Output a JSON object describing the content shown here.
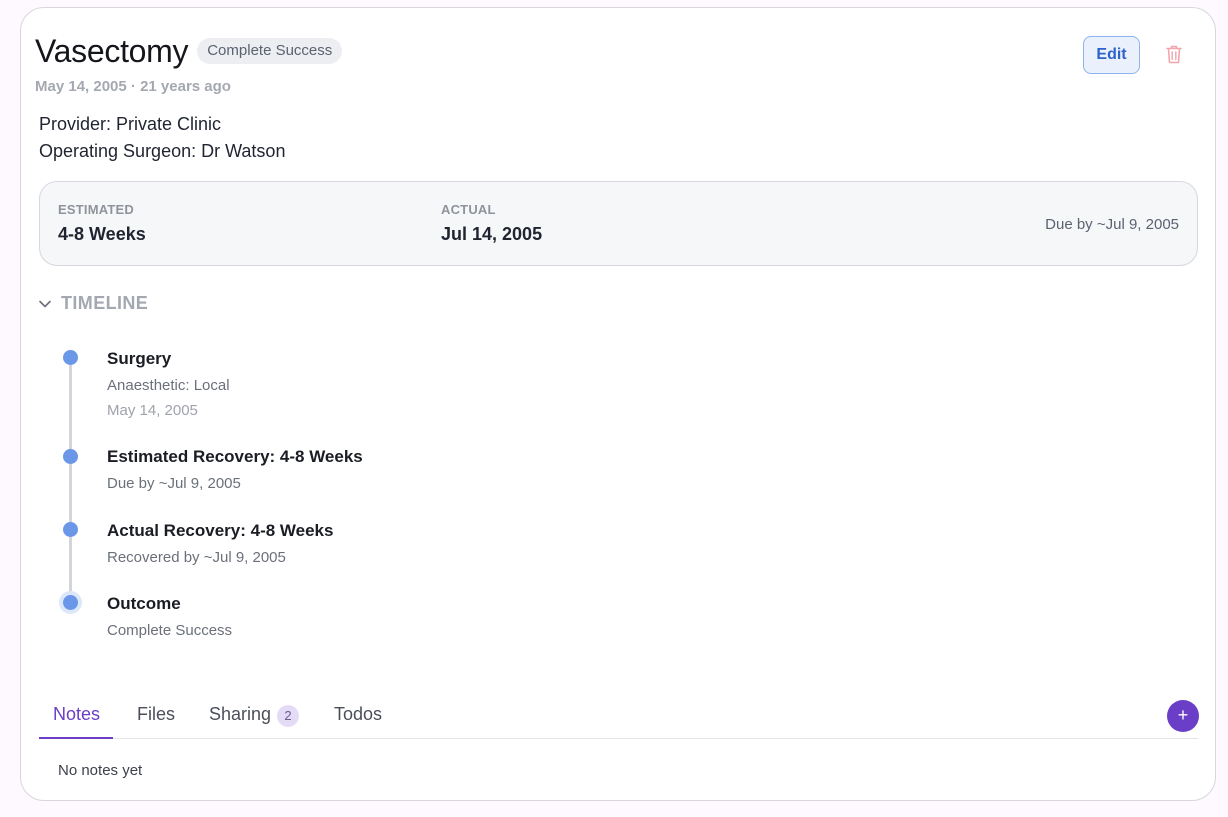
{
  "procedure": {
    "title": "Vasectomy",
    "status": "Complete Success",
    "date_line": "May 14, 2005 · 21 years ago",
    "edit_label": "Edit",
    "provider_line": "Provider: Private Clinic",
    "surgeon_line": "Operating Surgeon: Dr Watson"
  },
  "recovery": {
    "estimated_label": "ESTIMATED",
    "estimated_value": "4-8 Weeks",
    "actual_label": "ACTUAL",
    "actual_value": "Jul 14, 2005",
    "due_text": "Due by ~Jul 9, 2005"
  },
  "timeline": {
    "header": "TIMELINE",
    "events": [
      {
        "title": "Surgery",
        "sub": "Anaesthetic: Local",
        "date": "May 14, 2005"
      },
      {
        "title": "Estimated Recovery: 4-8 Weeks",
        "sub": "Due by ~Jul 9, 2005"
      },
      {
        "title": "Actual Recovery: 4-8 Weeks",
        "sub": "Recovered by ~Jul 9, 2005"
      },
      {
        "title": "Outcome",
        "sub": "Complete Success"
      }
    ]
  },
  "tabs": {
    "items": [
      {
        "label": "Notes",
        "active": true
      },
      {
        "label": "Files"
      },
      {
        "label": "Sharing",
        "count": "2"
      },
      {
        "label": "Todos"
      }
    ],
    "add_label": "+"
  },
  "notes": {
    "empty_text": "No notes yet"
  },
  "colors": {
    "accent": "#6a3ec6",
    "timeline_dot": "#6a97e8",
    "edit_blue": "#2e62c8",
    "trash": "#f1a6ad"
  },
  "icons": {
    "chevron": "chevron-down-icon",
    "trash": "trash-icon",
    "add": "plus-icon"
  }
}
